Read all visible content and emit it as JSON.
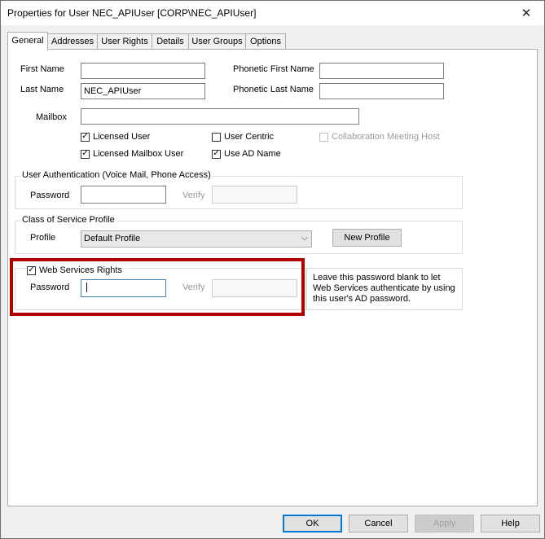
{
  "window": {
    "title": "Properties for User NEC_APIUser [CORP\\NEC_APIUser]",
    "close_glyph": "✕"
  },
  "tabs": [
    {
      "label": "General",
      "active": true
    },
    {
      "label": "Addresses"
    },
    {
      "label": "User Rights"
    },
    {
      "label": "Details"
    },
    {
      "label": "User Groups"
    },
    {
      "label": "Options"
    }
  ],
  "general": {
    "first_name_label": "First Name",
    "first_name_value": "",
    "last_name_label": "Last Name",
    "last_name_value": "NEC_APIUser",
    "phonetic_first_label": "Phonetic  First Name",
    "phonetic_first_value": "",
    "phonetic_last_label": "Phonetic Last Name",
    "phonetic_last_value": "",
    "mailbox_label": "Mailbox",
    "mailbox_value": "",
    "checkboxes": [
      {
        "label": "Licensed User",
        "checked": true,
        "enabled": true
      },
      {
        "label": "User Centric",
        "checked": false,
        "enabled": true
      },
      {
        "label": "Collaboration Meeting Host",
        "checked": false,
        "enabled": false
      },
      {
        "label": "Licensed Mailbox User",
        "checked": true,
        "enabled": true
      },
      {
        "label": "Use AD Name",
        "checked": true,
        "enabled": true
      }
    ]
  },
  "user_auth": {
    "title": "User Authentication (Voice Mail, Phone Access)",
    "password_label": "Password",
    "verify_label": "Verify"
  },
  "cos": {
    "title": "Class of Service Profile",
    "profile_label": "Profile",
    "profile_value": "Default Profile",
    "new_profile_label": "New Profile"
  },
  "web_services": {
    "title": "Web Services Rights",
    "checked": true,
    "password_label": "Password",
    "verify_label": "Verify",
    "note": "Leave this password blank to let Web Services authenticate by using this user's AD password."
  },
  "footer": {
    "ok": "OK",
    "cancel": "Cancel",
    "apply": "Apply",
    "help": "Help"
  },
  "icons": {
    "check": "✓",
    "chevron": "⌵"
  }
}
